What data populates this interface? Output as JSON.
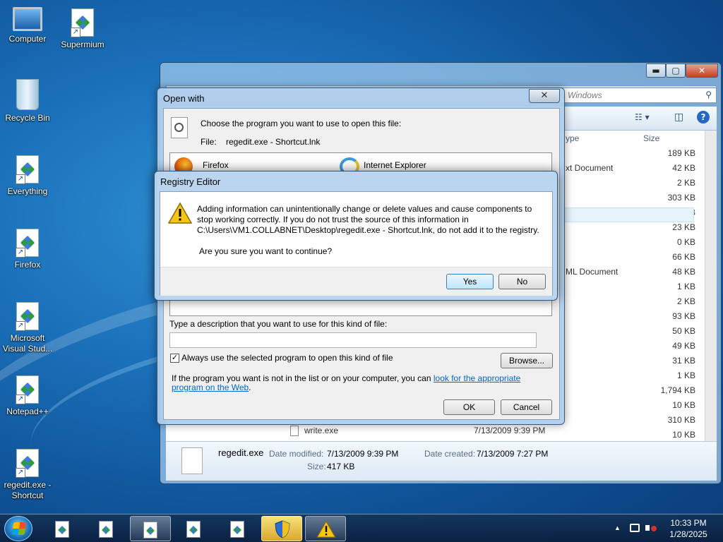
{
  "desktop": {
    "icons": [
      {
        "label": "Computer",
        "icon": "computer-icon"
      },
      {
        "label": "Supermium",
        "icon": "shortcut-file-icon"
      },
      {
        "label": "Recycle Bin",
        "icon": "recycle-bin-icon"
      },
      {
        "label": "Everything",
        "icon": "shortcut-file-icon"
      },
      {
        "label": "Firefox",
        "icon": "shortcut-file-icon"
      },
      {
        "label": "Microsoft Visual Stud...",
        "icon": "shortcut-file-icon"
      },
      {
        "label": "Notepad++",
        "icon": "shortcut-file-icon"
      },
      {
        "label": "regedit.exe - Shortcut",
        "icon": "shortcut-file-icon"
      }
    ]
  },
  "explorer": {
    "search_placeholder": "rch Windows",
    "min_glyph": "▬",
    "max_glyph": "▢",
    "close_glyph": "✕",
    "search_glyph": "⚲",
    "views_glyph": "☷ ▾",
    "preview_glyph": "◫",
    "help_glyph": "?",
    "columns": {
      "type": "ype",
      "size": "Size"
    },
    "type_values": [
      "xt Document",
      "ML Document"
    ],
    "sizes": [
      "189 KB",
      "42 KB",
      "2 KB",
      "303 KB",
      "417 KB",
      "23 KB",
      "0 KB",
      "66 KB",
      "48 KB",
      "1 KB",
      "2 KB",
      "93 KB",
      "50 KB",
      "49 KB",
      "31 KB",
      "1 KB",
      "1,794 KB",
      "10 KB",
      "310 KB",
      "10 KB"
    ],
    "last_row": {
      "name": "write.exe",
      "date": "7/13/2009 9:39 PM"
    },
    "details": {
      "filename": "regedit.exe",
      "date_modified_label": "Date modified:",
      "date_modified": "7/13/2009 9:39 PM",
      "date_created_label": "Date created:",
      "date_created": "7/13/2009 7:27 PM",
      "size_label": "Size:",
      "size": "417 KB"
    }
  },
  "open_with": {
    "title": "Open with",
    "close_glyph": "✕",
    "instruction": "Choose the program you want to use to open this file:",
    "file_label": "File:",
    "file_name": "regedit.exe - Shortcut.lnk",
    "programs": [
      "Firefox",
      "Internet Explorer"
    ],
    "description_label": "Type a description that you want to use for this kind of file:",
    "description_value": "",
    "always_use_label": "Always use the selected program to open this kind of file",
    "always_use_checked": true,
    "checkmark": "✓",
    "browse_label": "Browse...",
    "hint_text": "If the program you want is not in the list or on your computer, you can ",
    "hint_link": "look for the appropriate program on the Web",
    "hint_end": ".",
    "ok_label": "OK",
    "cancel_label": "Cancel"
  },
  "registry_dialog": {
    "title": "Registry Editor",
    "message": "Adding information can unintentionally change or delete values and cause components to stop working correctly. If you do not trust the source of this information in C:\\Users\\VM1.COLLABNET\\Desktop\\regedit.exe - Shortcut.lnk, do not add it to the registry.",
    "question": "Are you sure you want to continue?",
    "yes_label": "Yes",
    "no_label": "No"
  },
  "taskbar": {
    "items": [
      "shortcut-file-icon",
      "shortcut-file-icon",
      "shortcut-file-icon",
      "shortcut-file-icon",
      "shortcut-file-icon",
      "uac-shield-icon",
      "warning-icon"
    ],
    "tray_up": "▲",
    "clock_time": "10:33 PM",
    "clock_date": "1/28/2025"
  }
}
